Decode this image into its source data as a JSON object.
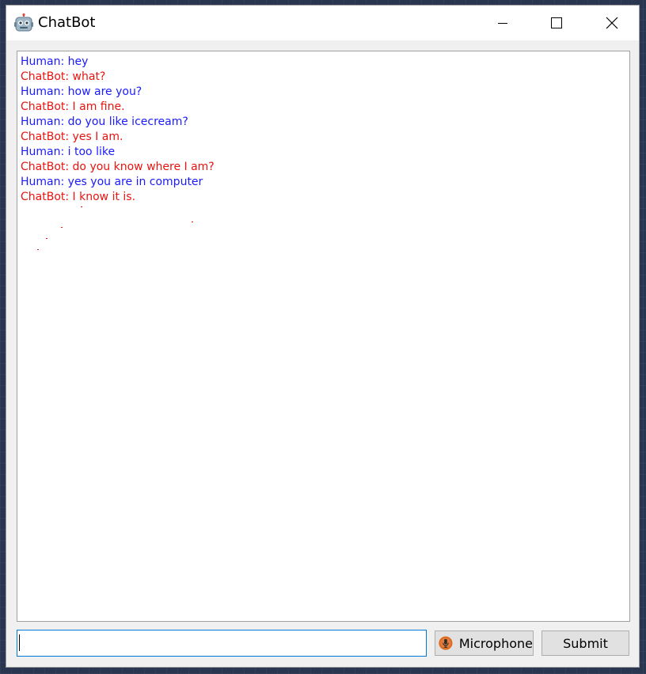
{
  "window": {
    "title": "ChatBot",
    "app_icon": "robot-icon",
    "controls": [
      "minimize-icon",
      "maximize-icon",
      "close-icon"
    ]
  },
  "chat": {
    "messages": [
      {
        "speaker": "human",
        "text": "Human: hey"
      },
      {
        "speaker": "bot",
        "text": "ChatBot: what?"
      },
      {
        "speaker": "human",
        "text": "Human: how are you?"
      },
      {
        "speaker": "bot",
        "text": "ChatBot: I am fine."
      },
      {
        "speaker": "human",
        "text": "Human: do you like icecream?"
      },
      {
        "speaker": "bot",
        "text": "ChatBot: yes I am."
      },
      {
        "speaker": "human",
        "text": "Human: i too like"
      },
      {
        "speaker": "bot",
        "text": "ChatBot: do you know where I am?"
      },
      {
        "speaker": "human",
        "text": "Human: yes you are in computer"
      },
      {
        "speaker": "bot",
        "text": "ChatBot: I know it is."
      }
    ],
    "colors": {
      "human": "#1a1aff",
      "bot": "#e8140f"
    }
  },
  "input": {
    "value": "",
    "placeholder": ""
  },
  "buttons": {
    "microphone_label": "Microphone",
    "microphone_icon": "microphone-icon",
    "submit_label": "Submit"
  }
}
